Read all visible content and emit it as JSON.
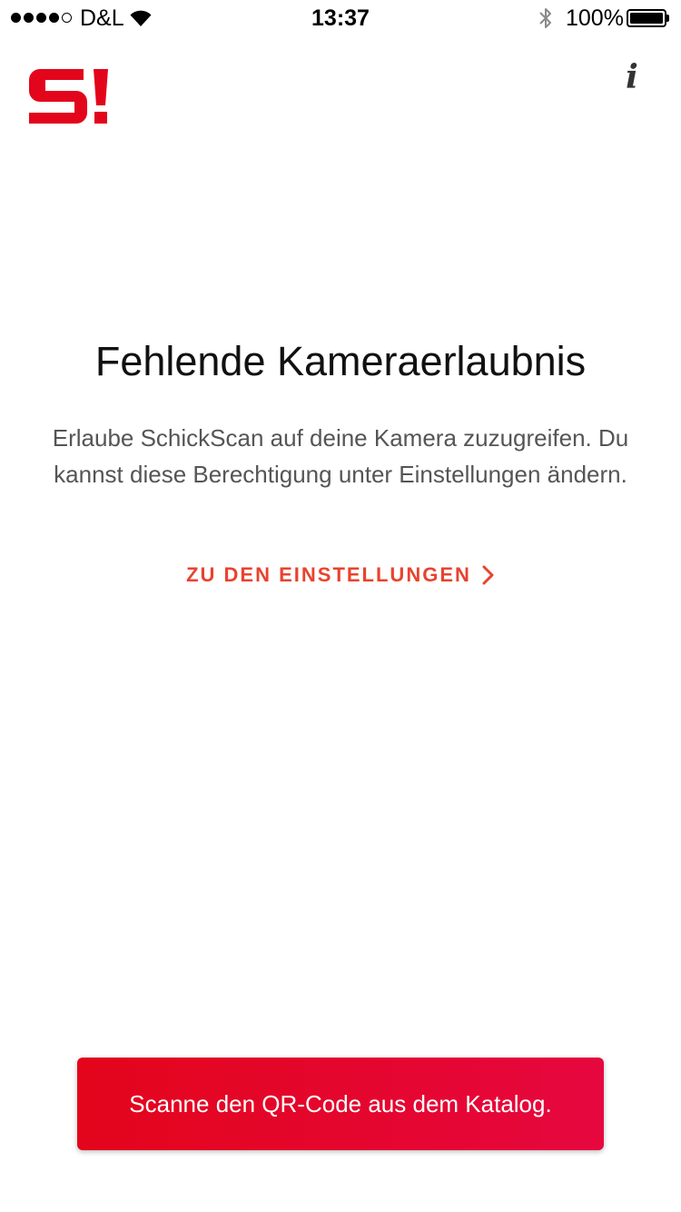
{
  "status_bar": {
    "carrier": "D&L",
    "time": "13:37",
    "battery_percent": "100%",
    "battery_level": 1.0,
    "signal_bars_filled": 4,
    "signal_bars_total": 5,
    "icons": [
      "signal-dots-icon",
      "wifi-icon",
      "bluetooth-icon",
      "battery-icon"
    ]
  },
  "header": {
    "logo_text": "S!",
    "info_label": "i",
    "brand_color": "#e3051b"
  },
  "content": {
    "title": "Fehlende Kameraerlaubnis",
    "message": "Erlaube SchickScan auf deine Kamera zuzugreifen. Du kannst diese Berechtigung unter Einstellungen ändern.",
    "settings_link": {
      "label": "ZU DEN EINSTELLUNGEN",
      "icon": "chevron-right-icon",
      "color": "#e8432e"
    }
  },
  "footer": {
    "scan_button_label": "Scanne den QR-Code aus dem Katalog."
  }
}
